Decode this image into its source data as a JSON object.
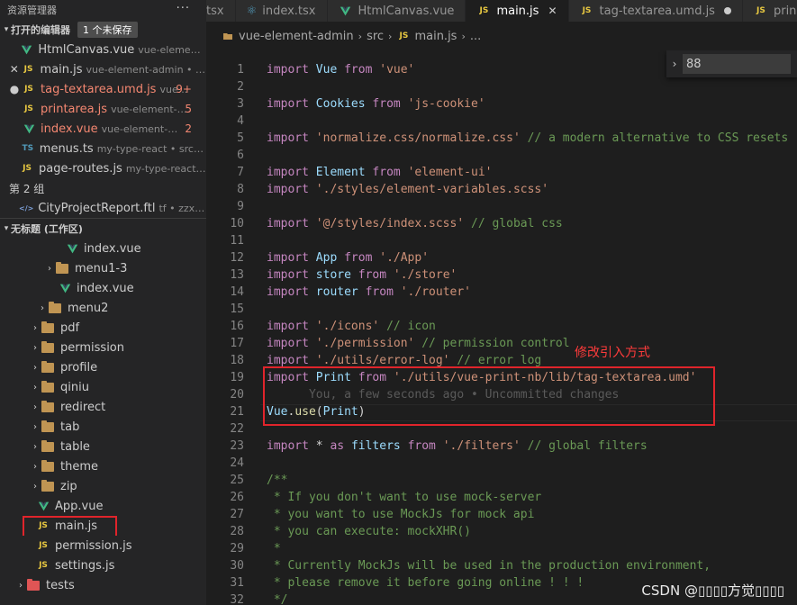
{
  "explorer": {
    "title": "资源管理器",
    "more": "···",
    "open_editors": {
      "header": "打开的编辑器",
      "badge": "1 个未保存",
      "items": [
        {
          "lead": "",
          "icon": "vue",
          "name": "HtmlCanvas.vue",
          "desc": "vue-element-a...",
          "num": ""
        },
        {
          "lead": "✕",
          "icon": "js",
          "name": "main.js",
          "desc": "vue-element-admin • src",
          "num": ""
        },
        {
          "lead": "●",
          "icon": "js",
          "name": "tag-textarea.umd.js",
          "desc": "vue...",
          "num": "9+"
        },
        {
          "lead": "",
          "icon": "js",
          "name": "printarea.js",
          "desc": "vue-element-a...",
          "num": "5"
        },
        {
          "lead": "",
          "icon": "vue",
          "name": "index.vue",
          "desc": "vue-element-ad...",
          "num": "2"
        },
        {
          "lead": "",
          "icon": "ts",
          "name": "menus.ts",
          "desc": "my-type-react • src\\la...",
          "num": ""
        },
        {
          "lead": "",
          "icon": "js",
          "name": "page-routes.js",
          "desc": "my-type-react • ...",
          "num": ""
        }
      ],
      "group2_label": "第 2 组",
      "group2_items": [
        {
          "icon": "ftl",
          "name": "CityProjectReport.ftl",
          "desc": "tf • zzxyp..."
        }
      ]
    },
    "workspace": {
      "header": "无标题 (工作区)",
      "tree": [
        {
          "indent": 72,
          "arrow": "",
          "icon": "vue",
          "name": "index.vue"
        },
        {
          "indent": 48,
          "arrow": "›",
          "icon": "folder",
          "name": "menu1-3"
        },
        {
          "indent": 64,
          "arrow": "",
          "icon": "vue",
          "name": "index.vue"
        },
        {
          "indent": 40,
          "arrow": "›",
          "icon": "folder",
          "name": "menu2"
        },
        {
          "indent": 32,
          "arrow": "›",
          "icon": "folder",
          "name": "pdf"
        },
        {
          "indent": 32,
          "arrow": "›",
          "icon": "folder",
          "name": "permission"
        },
        {
          "indent": 32,
          "arrow": "›",
          "icon": "folder",
          "name": "profile"
        },
        {
          "indent": 32,
          "arrow": "›",
          "icon": "folder",
          "name": "qiniu"
        },
        {
          "indent": 32,
          "arrow": "›",
          "icon": "folder",
          "name": "redirect"
        },
        {
          "indent": 32,
          "arrow": "›",
          "icon": "folder",
          "name": "tab"
        },
        {
          "indent": 32,
          "arrow": "›",
          "icon": "folder",
          "name": "table"
        },
        {
          "indent": 32,
          "arrow": "›",
          "icon": "folder",
          "name": "theme"
        },
        {
          "indent": 32,
          "arrow": "›",
          "icon": "folder",
          "name": "zip"
        },
        {
          "indent": 40,
          "arrow": "",
          "icon": "vue",
          "name": "App.vue"
        },
        {
          "indent": 40,
          "arrow": "",
          "icon": "js",
          "name": "main.js"
        },
        {
          "indent": 40,
          "arrow": "",
          "icon": "js",
          "name": "permission.js"
        },
        {
          "indent": 40,
          "arrow": "",
          "icon": "js",
          "name": "settings.js"
        },
        {
          "indent": 16,
          "arrow": "›",
          "icon": "tests",
          "name": "tests"
        }
      ]
    }
  },
  "tabs": [
    {
      "icon": "",
      "label": "tsx",
      "state": ""
    },
    {
      "icon": "react",
      "label": "index.tsx",
      "state": ""
    },
    {
      "icon": "vue",
      "label": "HtmlCanvas.vue",
      "state": ""
    },
    {
      "icon": "js",
      "label": "main.js",
      "state": "active"
    },
    {
      "icon": "js",
      "label": "tag-textarea.umd.js",
      "state": "dirty"
    },
    {
      "icon": "js",
      "label": "prin",
      "state": ""
    }
  ],
  "breadcrumb": [
    "vue-element-admin",
    "src",
    "main.js",
    "..."
  ],
  "find_widget": {
    "value": "88"
  },
  "code_lines": [
    {
      "n": "1",
      "t": [
        [
          "kw",
          "import "
        ],
        [
          "id",
          "Vue "
        ],
        [
          "kw",
          "from "
        ],
        [
          "str",
          "'vue'"
        ]
      ]
    },
    {
      "n": "2",
      "t": []
    },
    {
      "n": "3",
      "t": [
        [
          "kw",
          "import "
        ],
        [
          "id",
          "Cookies "
        ],
        [
          "kw",
          "from "
        ],
        [
          "str",
          "'js-cookie'"
        ]
      ]
    },
    {
      "n": "4",
      "t": []
    },
    {
      "n": "5",
      "t": [
        [
          "kw",
          "import "
        ],
        [
          "str",
          "'normalize.css/normalize.css'"
        ],
        [
          "cmt",
          " // a modern alternative to CSS resets"
        ]
      ]
    },
    {
      "n": "6",
      "t": []
    },
    {
      "n": "7",
      "t": [
        [
          "kw",
          "import "
        ],
        [
          "id",
          "Element "
        ],
        [
          "kw",
          "from "
        ],
        [
          "str",
          "'element-ui'"
        ]
      ]
    },
    {
      "n": "8",
      "t": [
        [
          "kw",
          "import "
        ],
        [
          "str",
          "'./styles/element-variables.scss'"
        ]
      ]
    },
    {
      "n": "9",
      "t": []
    },
    {
      "n": "10",
      "t": [
        [
          "kw",
          "import "
        ],
        [
          "str",
          "'@/styles/index.scss'"
        ],
        [
          "cmt",
          " // global css"
        ]
      ]
    },
    {
      "n": "11",
      "t": []
    },
    {
      "n": "12",
      "t": [
        [
          "kw",
          "import "
        ],
        [
          "id",
          "App "
        ],
        [
          "kw",
          "from "
        ],
        [
          "str",
          "'./App'"
        ]
      ]
    },
    {
      "n": "13",
      "t": [
        [
          "kw",
          "import "
        ],
        [
          "id",
          "store "
        ],
        [
          "kw",
          "from "
        ],
        [
          "str",
          "'./store'"
        ]
      ]
    },
    {
      "n": "14",
      "t": [
        [
          "kw",
          "import "
        ],
        [
          "id",
          "router "
        ],
        [
          "kw",
          "from "
        ],
        [
          "str",
          "'./router'"
        ]
      ]
    },
    {
      "n": "15",
      "t": []
    },
    {
      "n": "16",
      "t": [
        [
          "kw",
          "import "
        ],
        [
          "str",
          "'./icons'"
        ],
        [
          "cmt",
          " // icon"
        ]
      ]
    },
    {
      "n": "17",
      "t": [
        [
          "kw",
          "import "
        ],
        [
          "str",
          "'./permission'"
        ],
        [
          "cmt",
          " // permission control"
        ]
      ]
    },
    {
      "n": "18",
      "t": [
        [
          "kw",
          "import "
        ],
        [
          "str",
          "'./utils/error-log'"
        ],
        [
          "cmt",
          " // error log"
        ]
      ]
    },
    {
      "n": "19",
      "t": [
        [
          "kw",
          "import "
        ],
        [
          "id",
          "Print "
        ],
        [
          "kw",
          "from "
        ],
        [
          "str",
          "'./utils/vue-print-nb/lib/tag-textarea.umd'"
        ]
      ]
    },
    {
      "n": "20",
      "t": [
        [
          "blame",
          "      You, a few seconds ago • Uncommitted changes"
        ]
      ]
    },
    {
      "n": "21",
      "t": [
        [
          "id",
          "Vue"
        ],
        [
          "plain",
          "."
        ],
        [
          "fn",
          "use"
        ],
        [
          "plain",
          "("
        ],
        [
          "id",
          "Print"
        ],
        [
          "plain",
          ")"
        ]
      ]
    },
    {
      "n": "22",
      "t": []
    },
    {
      "n": "23",
      "t": [
        [
          "kw",
          "import "
        ],
        [
          "plain",
          "* "
        ],
        [
          "kw",
          "as "
        ],
        [
          "id",
          "filters "
        ],
        [
          "kw",
          "from "
        ],
        [
          "str",
          "'./filters'"
        ],
        [
          "cmt",
          " // global filters"
        ]
      ]
    },
    {
      "n": "24",
      "t": []
    },
    {
      "n": "25",
      "t": [
        [
          "cmt",
          "/**"
        ]
      ]
    },
    {
      "n": "26",
      "t": [
        [
          "cmt",
          " * If you don't want to use mock-server"
        ]
      ]
    },
    {
      "n": "27",
      "t": [
        [
          "cmt",
          " * you want to use MockJs for mock api"
        ]
      ]
    },
    {
      "n": "28",
      "t": [
        [
          "cmt",
          " * you can execute: mockXHR()"
        ]
      ]
    },
    {
      "n": "29",
      "t": [
        [
          "cmt",
          " *"
        ]
      ]
    },
    {
      "n": "30",
      "t": [
        [
          "cmt",
          " * Currently MockJs will be used in the production environment,"
        ]
      ]
    },
    {
      "n": "31",
      "t": [
        [
          "cmt",
          " * please remove it before going online ! ! !"
        ]
      ]
    },
    {
      "n": "32",
      "t": [
        [
          "cmt",
          " */"
        ]
      ]
    }
  ],
  "annotation": {
    "label": "修改引入方式"
  },
  "watermark": "CSDN @▯▯▯▯方觉▯▯▯▯",
  "colors": {
    "accent_red": "#e0242b",
    "keyword": "#c586c0",
    "string": "#ce9178",
    "comment": "#6a9955",
    "identifier": "#9cdcfe"
  }
}
